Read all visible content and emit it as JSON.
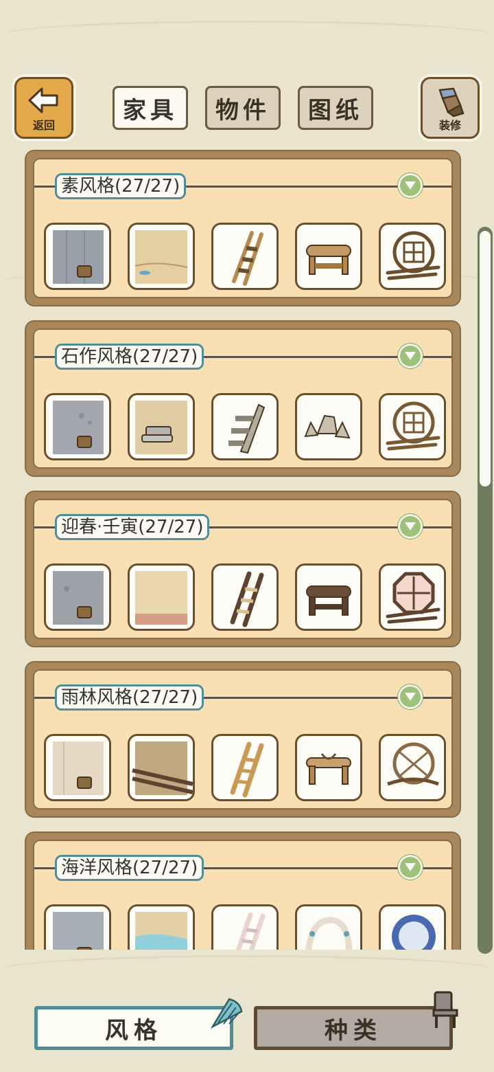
{
  "top_bar": {
    "back_label": "返回",
    "decorate_label": "装修",
    "tabs": [
      {
        "label": "家具",
        "active": true
      },
      {
        "label": "物件",
        "active": false
      },
      {
        "label": "图纸",
        "active": false
      }
    ]
  },
  "style_sets": [
    {
      "title": "素风格(27/27)",
      "items": [
        "wall",
        "floor",
        "ladder",
        "log-bench",
        "round-window"
      ]
    },
    {
      "title": "石作风格(27/27)",
      "items": [
        "wall",
        "floor",
        "stone-stairs",
        "rocks",
        "round-window"
      ]
    },
    {
      "title": "迎春·壬寅(27/27)",
      "items": [
        "wall",
        "floor",
        "ladder",
        "log-bench",
        "octagon-window"
      ]
    },
    {
      "title": "雨林风格(27/27)",
      "items": [
        "wall",
        "floor",
        "ladder",
        "rope-bench",
        "vine-window"
      ]
    },
    {
      "title": "海洋风格(27/27)",
      "items": [
        "wall",
        "floor",
        "ladder",
        "shell-arch",
        "porthole-window"
      ]
    }
  ],
  "scroll": {
    "position_fraction": 0.0,
    "visible_fraction": 0.36
  },
  "bottom_tabs": [
    {
      "label": "风格",
      "active": true,
      "icon": "seashell-icon"
    },
    {
      "label": "种类",
      "active": false,
      "icon": "chair-icon"
    }
  ],
  "colors": {
    "background": "#e8e4cd",
    "panel_frame": "#a8875b",
    "panel_fill": "#f8e0b4",
    "accent_teal": "#4f8e96",
    "collapse_green": "#9ec17a"
  }
}
